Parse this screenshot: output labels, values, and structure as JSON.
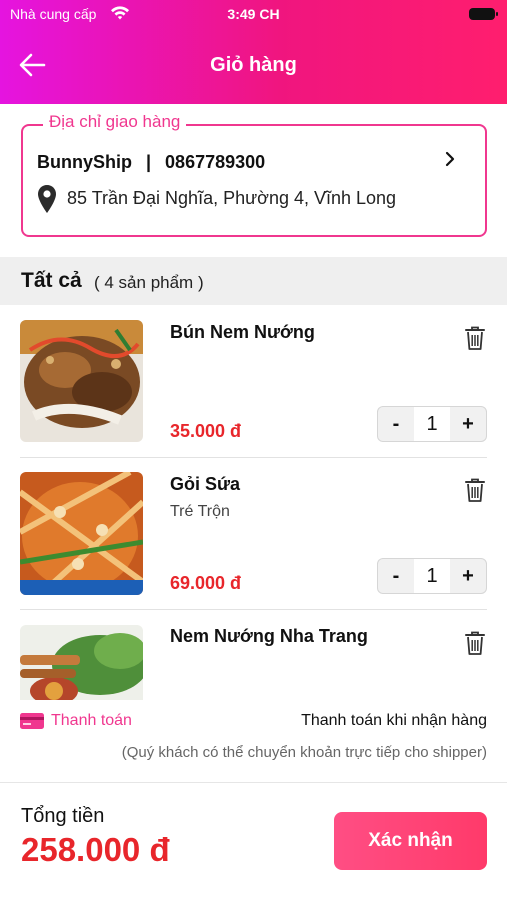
{
  "status_bar": {
    "carrier": "Nhà cung cấp",
    "time": "3:49 CH"
  },
  "header": {
    "title": "Giỏ hàng"
  },
  "address": {
    "legend": "Địa chỉ giao hàng",
    "name": "BunnyShip",
    "separator": "|",
    "phone": "0867789300",
    "line": "85 Trần Đại Nghĩa, Phường 4, Vĩnh Long"
  },
  "section": {
    "title": "Tất cả",
    "count": "( 4 sản phẩm )"
  },
  "items": [
    {
      "name": "Bún Nem Nướng",
      "subtitle": "",
      "price": "35.000 đ",
      "qty": "1"
    },
    {
      "name": "Gỏi Sứa",
      "subtitle": "Tré Trộn",
      "price": "69.000 đ",
      "qty": "1"
    },
    {
      "name": "Nem Nướng Nha Trang",
      "subtitle": "",
      "price": "",
      "qty": ""
    }
  ],
  "stepper": {
    "minus": "-",
    "plus": "+"
  },
  "payment": {
    "label": "Thanh toán",
    "method": "Thanh toán khi nhận hàng",
    "note": "(Quý khách có thể chuyển khoản trực tiếp cho shipper)"
  },
  "footer": {
    "total_label": "Tổng tiền",
    "total_value": "258.000 đ",
    "confirm_label": "Xác nhận"
  },
  "colors": {
    "accent": "#f0378f",
    "price": "#e8262b",
    "header_start": "#e514e0",
    "header_end": "#ff1e6e"
  }
}
